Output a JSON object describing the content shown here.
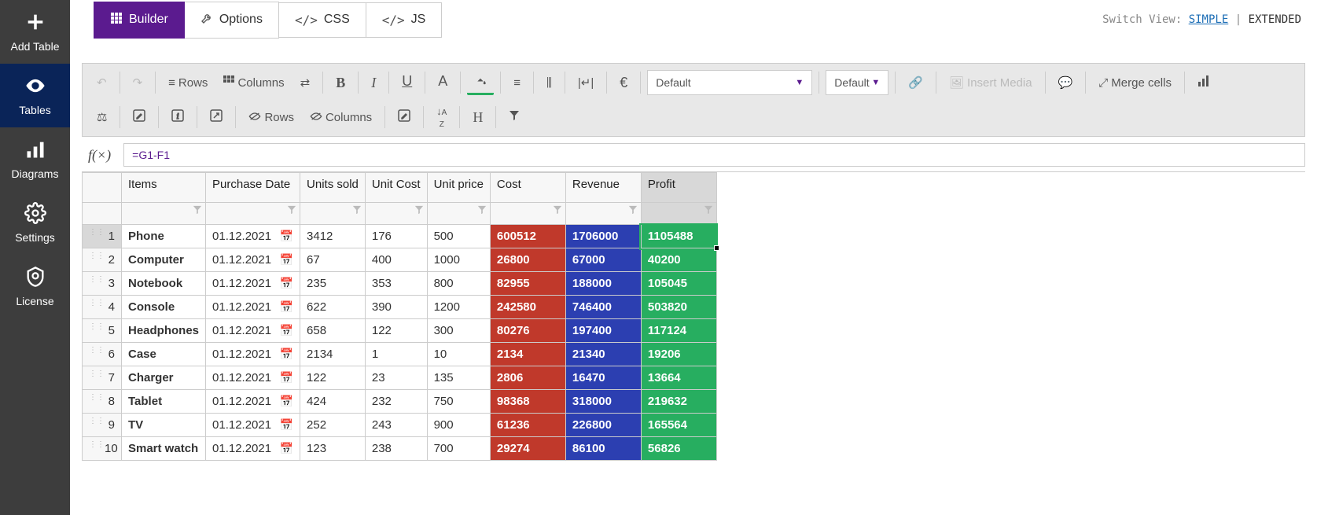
{
  "sidebar": {
    "items": [
      {
        "label": "Add Table",
        "icon": "plus"
      },
      {
        "label": "Tables",
        "icon": "eye"
      },
      {
        "label": "Diagrams",
        "icon": "bars"
      },
      {
        "label": "Settings",
        "icon": "gear"
      },
      {
        "label": "License",
        "icon": "shield"
      }
    ]
  },
  "tabs": {
    "items": [
      {
        "label": "Builder",
        "icon": "grid"
      },
      {
        "label": "Options",
        "icon": "wrench"
      },
      {
        "label": "CSS",
        "icon": "code"
      },
      {
        "label": "JS",
        "icon": "code"
      }
    ]
  },
  "switch_view": {
    "prefix": "Switch View: ",
    "simple": "SIMPLE",
    "extended": "EXTENDED"
  },
  "toolbar": {
    "rows": "Rows",
    "columns": "Columns",
    "font_family": "Default",
    "font_size": "Default",
    "insert_media": "Insert Media",
    "merge_cells": "Merge cells",
    "row2_rows": "Rows",
    "row2_columns": "Columns"
  },
  "formula": "=G1-F1",
  "table": {
    "headers": [
      "Items",
      "Purchase Date",
      "Units sold",
      "Unit Cost",
      "Unit price",
      "Cost",
      "Revenue",
      "Profit"
    ],
    "rows": [
      {
        "n": "1",
        "item": "Phone",
        "date": "01.12.2021",
        "units": "3412",
        "ucost": "176",
        "uprice": "500",
        "cost": "600512",
        "rev": "1706000",
        "prof": "1105488"
      },
      {
        "n": "2",
        "item": "Computer",
        "date": "01.12.2021",
        "units": "67",
        "ucost": "400",
        "uprice": "1000",
        "cost": "26800",
        "rev": "67000",
        "prof": "40200"
      },
      {
        "n": "3",
        "item": "Notebook",
        "date": "01.12.2021",
        "units": "235",
        "ucost": "353",
        "uprice": "800",
        "cost": "82955",
        "rev": "188000",
        "prof": "105045"
      },
      {
        "n": "4",
        "item": "Console",
        "date": "01.12.2021",
        "units": "622",
        "ucost": "390",
        "uprice": "1200",
        "cost": "242580",
        "rev": "746400",
        "prof": "503820"
      },
      {
        "n": "5",
        "item": "Headphones",
        "date": "01.12.2021",
        "units": "658",
        "ucost": "122",
        "uprice": "300",
        "cost": "80276",
        "rev": "197400",
        "prof": "117124"
      },
      {
        "n": "6",
        "item": "Case",
        "date": "01.12.2021",
        "units": "2134",
        "ucost": "1",
        "uprice": "10",
        "cost": "2134",
        "rev": "21340",
        "prof": "19206"
      },
      {
        "n": "7",
        "item": "Charger",
        "date": "01.12.2021",
        "units": "122",
        "ucost": "23",
        "uprice": "135",
        "cost": "2806",
        "rev": "16470",
        "prof": "13664"
      },
      {
        "n": "8",
        "item": "Tablet",
        "date": "01.12.2021",
        "units": "424",
        "ucost": "232",
        "uprice": "750",
        "cost": "98368",
        "rev": "318000",
        "prof": "219632"
      },
      {
        "n": "9",
        "item": "TV",
        "date": "01.12.2021",
        "units": "252",
        "ucost": "243",
        "uprice": "900",
        "cost": "61236",
        "rev": "226800",
        "prof": "165564"
      },
      {
        "n": "10",
        "item": "Smart watch",
        "date": "01.12.2021",
        "units": "123",
        "ucost": "238",
        "uprice": "700",
        "cost": "29274",
        "rev": "86100",
        "prof": "56826"
      }
    ]
  }
}
